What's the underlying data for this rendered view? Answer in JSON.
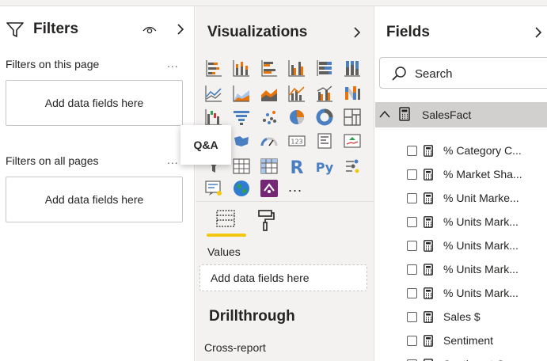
{
  "filters": {
    "title": "Filters",
    "section_page": "Filters on this page",
    "section_all": "Filters on all pages",
    "more": "...",
    "drop_page": "Add data fields here",
    "drop_all": "Add data fields here"
  },
  "visualizations": {
    "title": "Visualizations",
    "tooltip": "Q&A",
    "more": "...",
    "values_label": "Values",
    "values_drop": "Add data fields here",
    "drillthrough": "Drillthrough",
    "cross_report": "Cross-report",
    "icons": [
      "stacked-bar-icon",
      "stacked-column-icon",
      "clustered-bar-icon",
      "clustered-column-icon",
      "100-bar-icon",
      "100-column-icon",
      "line-chart-icon",
      "area-chart-icon",
      "stacked-area-icon",
      "line-column-icon",
      "line-clustered-icon",
      "ribbon-chart-icon",
      "waterfall-icon",
      "funnel-chart-icon",
      "scatter-icon",
      "pie-chart-icon",
      "donut-icon",
      "treemap-icon",
      "map-icon",
      "filled-map-icon",
      "gauge-icon",
      "card-icon",
      "multirow-card-icon",
      "kpi-icon",
      "slicer-icon",
      "table-icon",
      "matrix-icon",
      "r-visual-icon",
      "python-visual-icon",
      "key-influencers-icon",
      "smart-narrative-icon",
      "globe-icon",
      "power-apps-icon"
    ]
  },
  "fields": {
    "title": "Fields",
    "search_placeholder": "Search",
    "table_name": "SalesFact",
    "items": [
      "% Category C...",
      "% Market Sha...",
      "% Unit Marke...",
      "% Units Mark...",
      "% Units Mark...",
      "% Units Mark...",
      "% Units Mark...",
      "Sales $",
      "Sentiment",
      "Sentiment Gap"
    ]
  },
  "colors": {
    "accent_yellow": "#f2c811",
    "pane_gray": "#f3f2f1",
    "selected_row": "#d2d0ce"
  }
}
